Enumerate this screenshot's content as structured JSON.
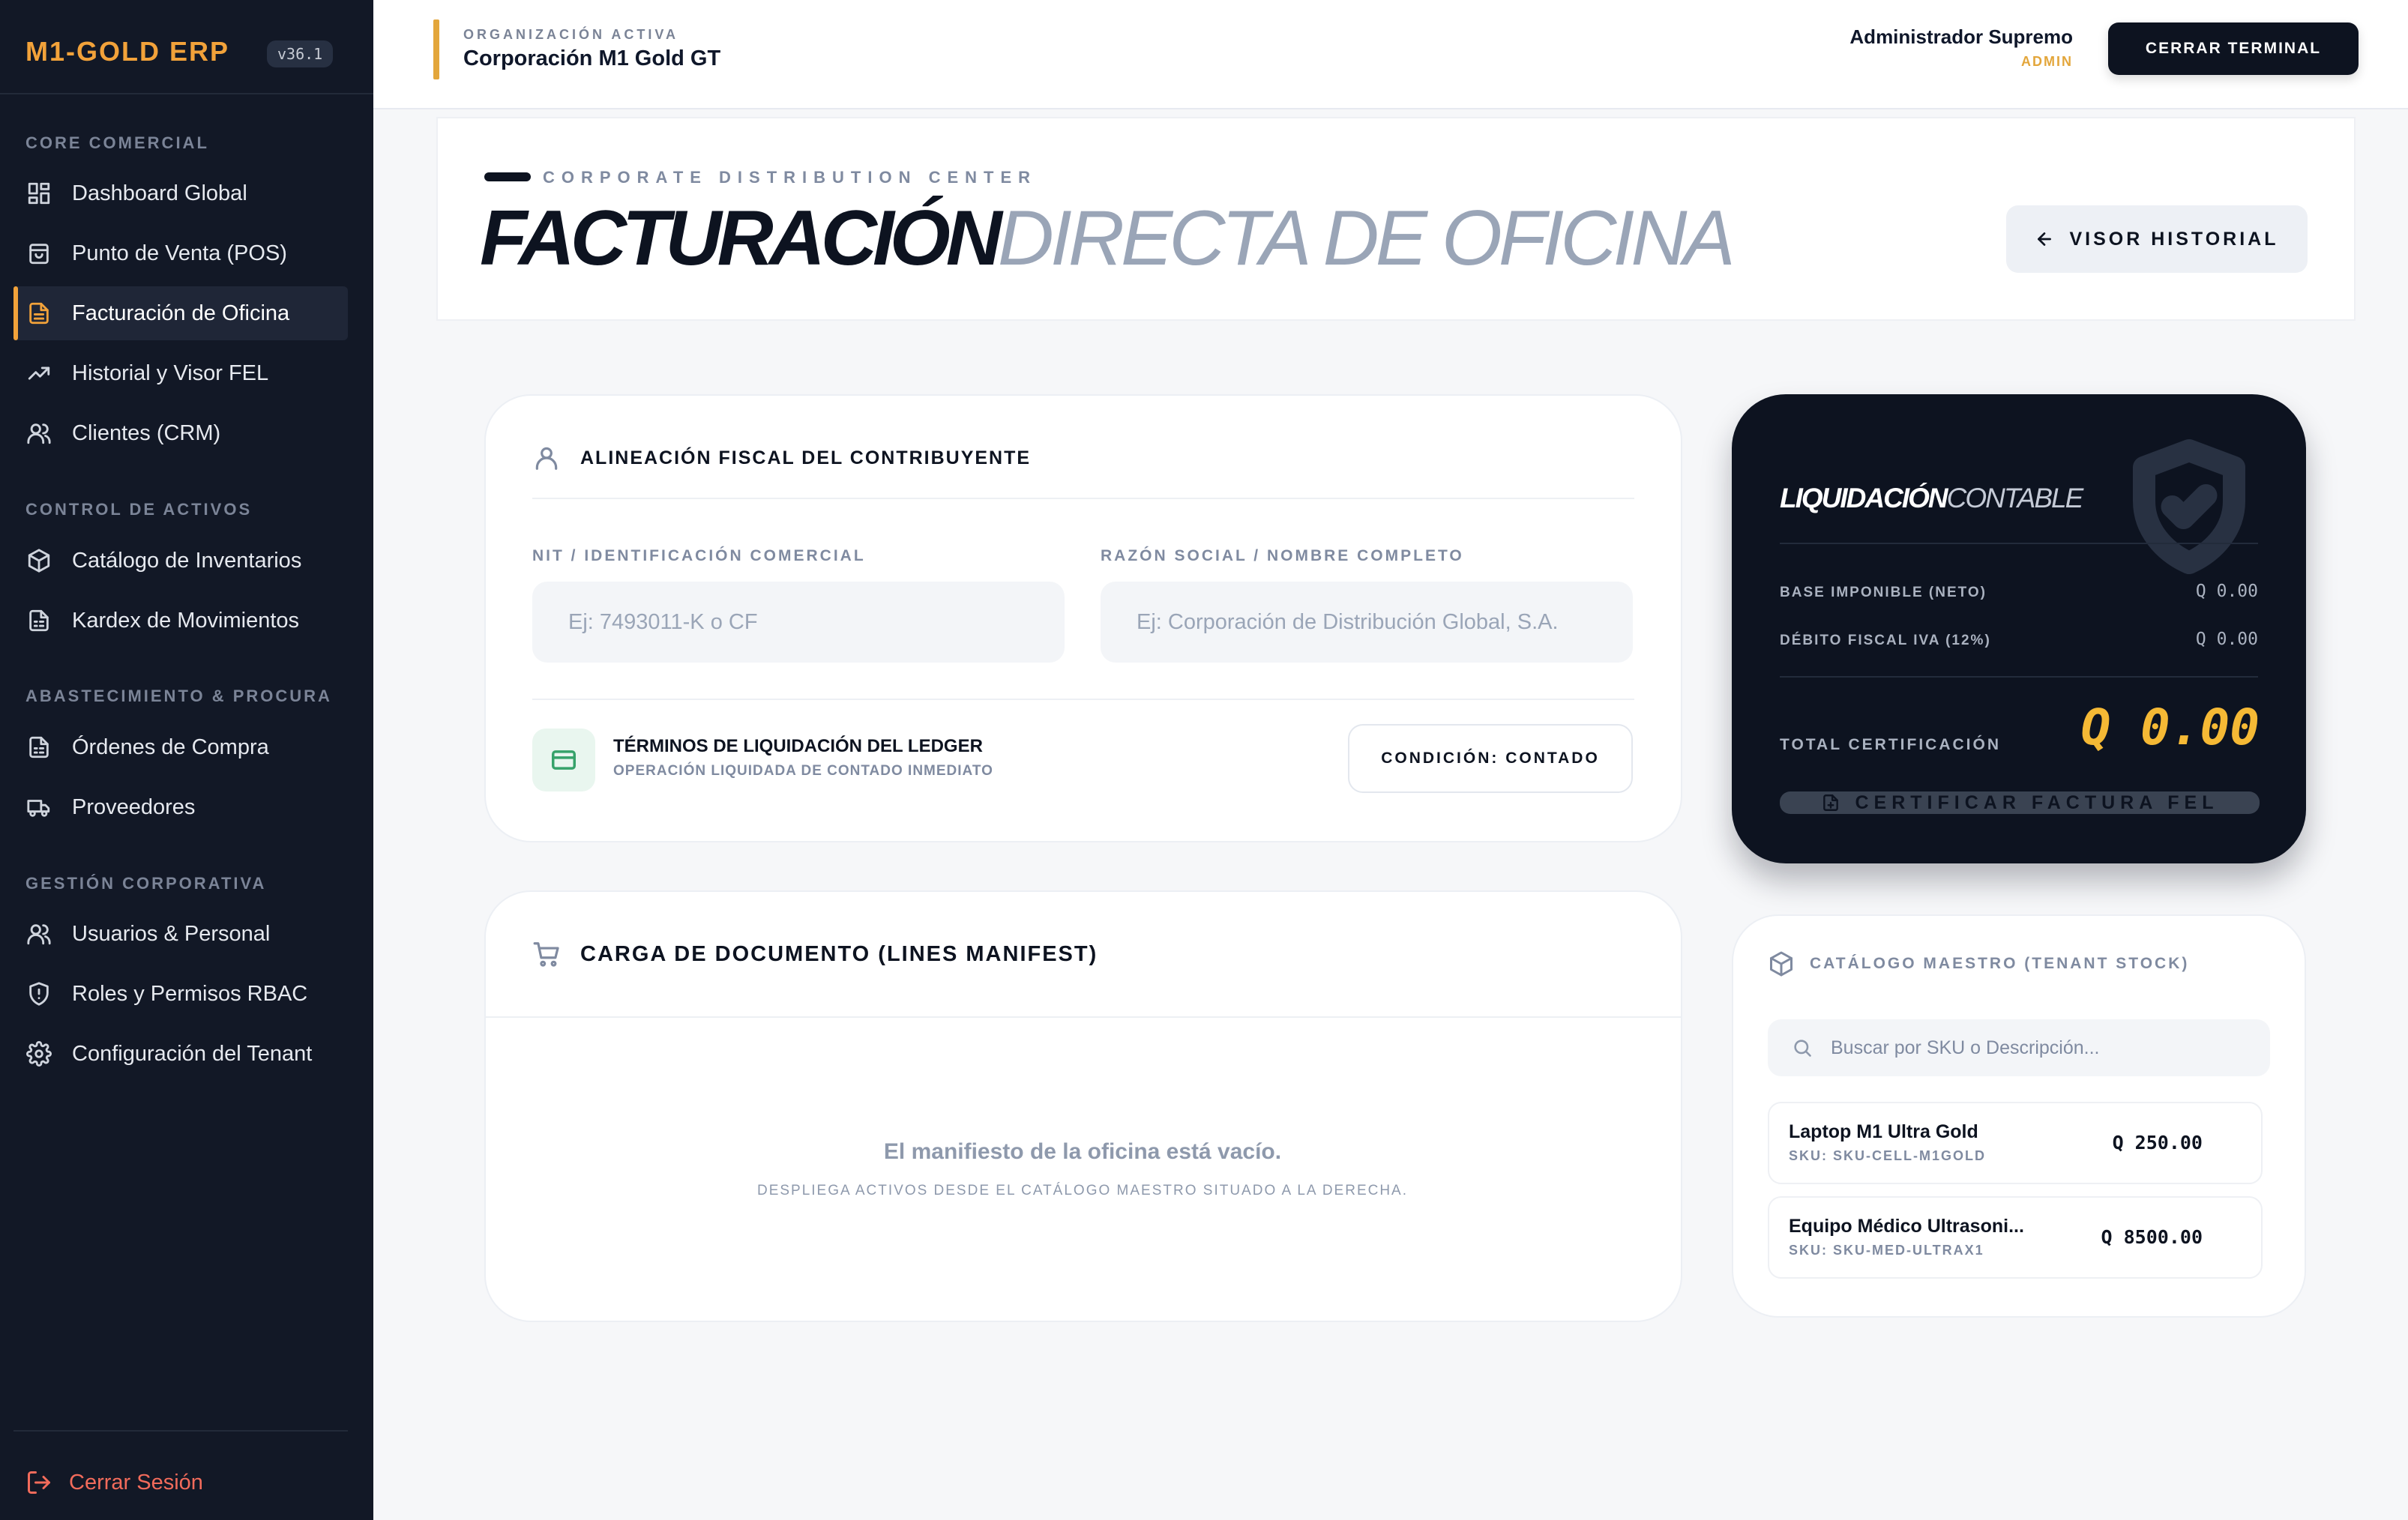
{
  "sidebar": {
    "brand": "M1-GOLD ERP",
    "version": "v36.1",
    "sections": [
      {
        "title": "CORE COMERCIAL",
        "items": [
          {
            "label": "Dashboard Global",
            "icon": "dashboard-icon"
          },
          {
            "label": "Punto de Venta (POS)",
            "icon": "shopping-bag-icon"
          },
          {
            "label": "Facturación de Oficina",
            "icon": "document-icon",
            "active": true
          },
          {
            "label": "Historial y Visor FEL",
            "icon": "trending-up-icon"
          },
          {
            "label": "Clientes (CRM)",
            "icon": "users-icon"
          }
        ]
      },
      {
        "title": "CONTROL DE ACTIVOS",
        "items": [
          {
            "label": "Catálogo de Inventarios",
            "icon": "box-icon"
          },
          {
            "label": "Kardex de Movimientos",
            "icon": "file-list-icon"
          }
        ]
      },
      {
        "title": "ABASTECIMIENTO & PROCURA",
        "items": [
          {
            "label": "Órdenes de Compra",
            "icon": "file-list-icon"
          },
          {
            "label": "Proveedores",
            "icon": "truck-icon"
          }
        ]
      },
      {
        "title": "GESTIÓN CORPORATIVA",
        "items": [
          {
            "label": "Usuarios & Personal",
            "icon": "users-icon"
          },
          {
            "label": "Roles y Permisos RBAC",
            "icon": "shield-icon"
          },
          {
            "label": "Configuración del Tenant",
            "icon": "gear-icon"
          }
        ]
      }
    ],
    "logout_label": "Cerrar Sesión"
  },
  "header": {
    "org_label": "ORGANIZACIÓN ACTIVA",
    "org_name": "Corporación M1 Gold GT",
    "user_name": "Administrador Supremo",
    "user_role": "ADMIN",
    "close_terminal": "CERRAR TERMINAL"
  },
  "page": {
    "kicker": "CORPORATE DISTRIBUTION CENTER",
    "title_bold": "FACTURACIÓN",
    "title_light": "DIRECTA DE OFICINA",
    "history_button": "VISOR HISTORIAL"
  },
  "fiscal": {
    "title": "ALINEACIÓN FISCAL DEL CONTRIBUYENTE",
    "nit_label": "NIT / IDENTIFICACIÓN COMERCIAL",
    "nit_placeholder": "Ej: 7493011-K o CF",
    "name_label": "RAZÓN SOCIAL / NOMBRE COMPLETO",
    "name_placeholder": "Ej: Corporación de Distribución Global, S.A.",
    "terms_title": "TÉRMINOS DE LIQUIDACIÓN DEL LEDGER",
    "terms_sub": "OPERACIÓN LIQUIDADA DE CONTADO INMEDIATO",
    "condition": "CONDICIÓN: CONTADO"
  },
  "manifest": {
    "title": "CARGA DE DOCUMENTO (LINES MANIFEST)",
    "empty_title": "El manifiesto de la oficina está vacío.",
    "empty_sub": "DESPLIEGA ACTIVOS DESDE EL CATÁLOGO MAESTRO SITUADO A LA DERECHA."
  },
  "summary": {
    "title_bold": "LIQUIDACIÓN",
    "title_light": "CONTABLE",
    "base_label": "BASE IMPONIBLE (NETO)",
    "base_value": "Q 0.00",
    "iva_label": "DÉBITO FISCAL IVA (12%)",
    "iva_value": "Q 0.00",
    "total_label": "TOTAL CERTIFICACIÓN",
    "total_value": "Q 0.00",
    "certify_button": "CERTIFICAR FACTURA FEL"
  },
  "catalog": {
    "title": "CATÁLOGO MAESTRO (TENANT STOCK)",
    "search_placeholder": "Buscar por SKU o Descripción...",
    "products": [
      {
        "name": "Laptop M1 Ultra Gold",
        "sku": "SKU: SKU-CELL-M1GOLD",
        "price": "Q 250.00"
      },
      {
        "name": "Equipo Médico Ultrasoni...",
        "sku": "SKU: SKU-MED-ULTRAX1",
        "price": "Q 8500.00"
      }
    ]
  },
  "colors": {
    "accent": "#f2a23a",
    "sidebar_bg": "#121826",
    "dark": "#0d1320",
    "total": "#f5b935",
    "logout": "#f26b5b"
  }
}
